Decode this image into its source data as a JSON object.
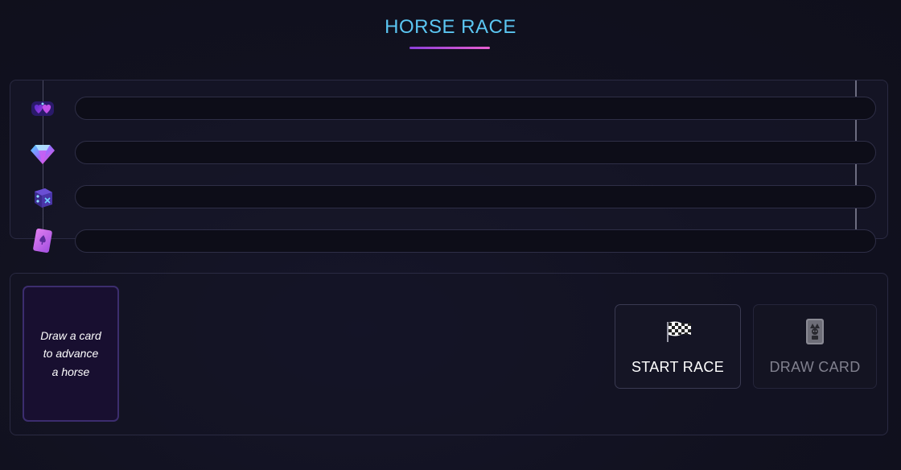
{
  "header": {
    "title": "HORSE RACE"
  },
  "track": {
    "racers": [
      {
        "name": "hearts-icon",
        "progress": 0
      },
      {
        "name": "diamond-icon",
        "progress": 0
      },
      {
        "name": "dice-icon",
        "progress": 0
      },
      {
        "name": "spade-card-icon",
        "progress": 0
      }
    ]
  },
  "card_slot": {
    "line1": "Draw a card",
    "line2": "to advance",
    "line3": "a horse"
  },
  "controls": {
    "start_label": "START RACE",
    "start_icon": "checkered-flag-icon",
    "draw_label": "DRAW CARD",
    "draw_icon": "joker-card-icon",
    "draw_enabled": false
  },
  "colors": {
    "title": "#5bc6f2",
    "accent_start": "#8b3fd9",
    "accent_end": "#e95fd0"
  }
}
